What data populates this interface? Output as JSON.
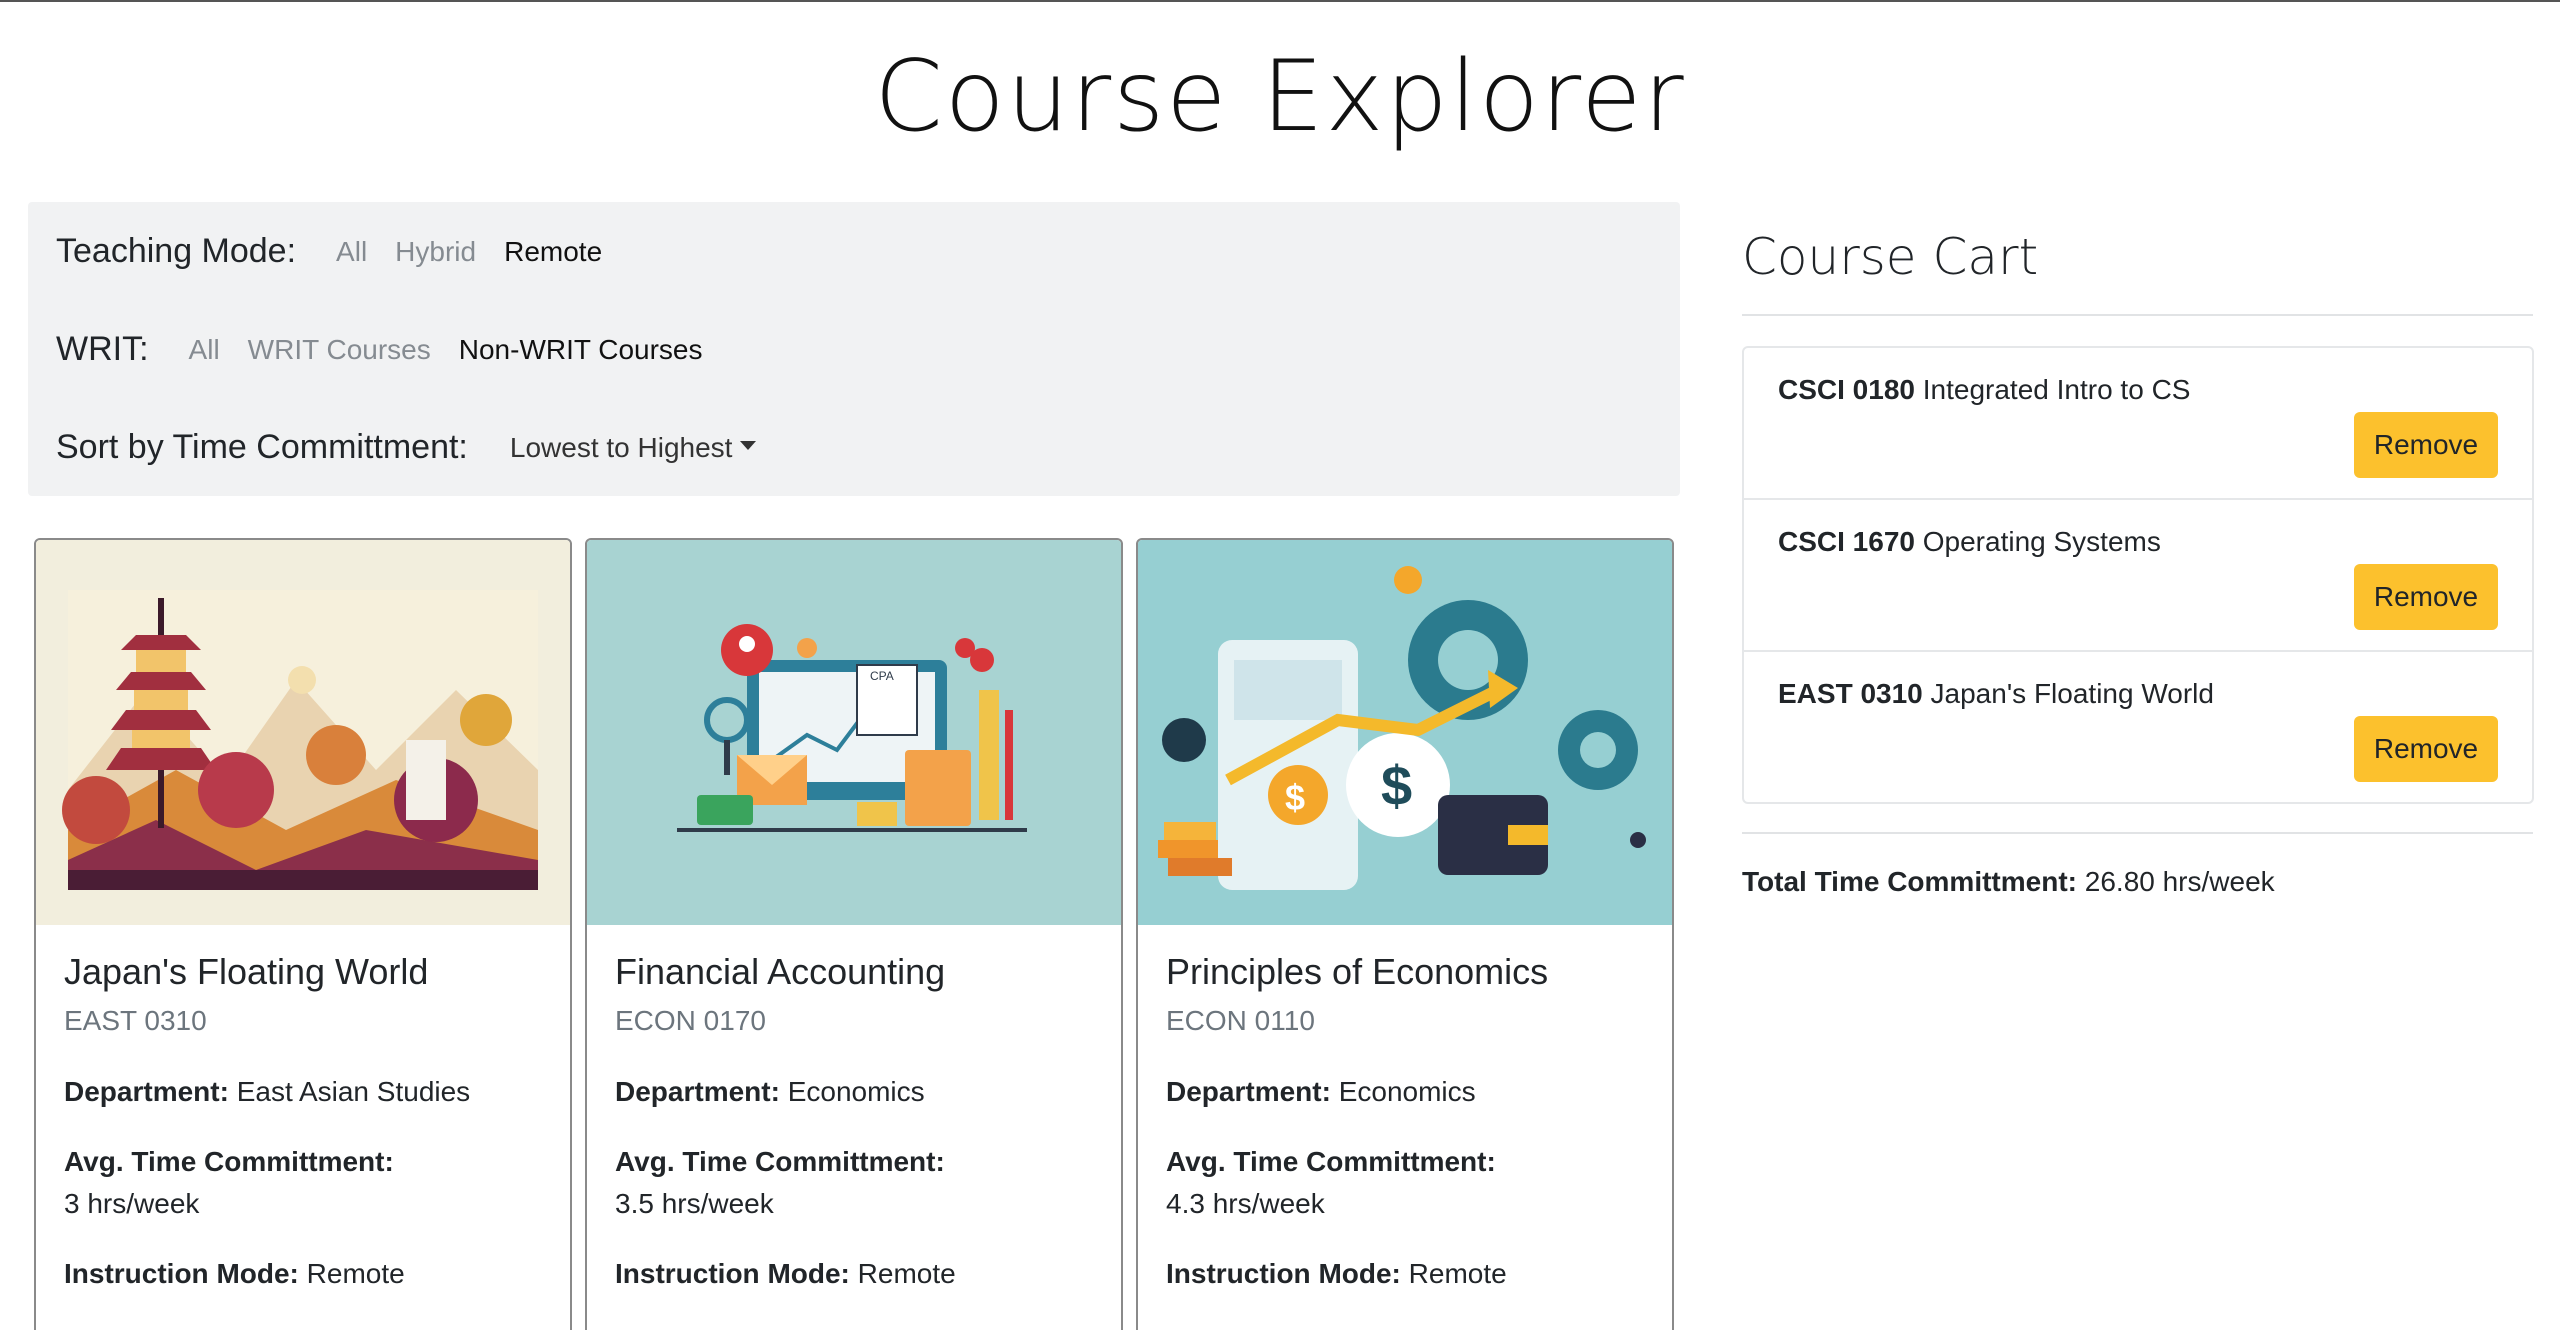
{
  "page": {
    "title": "Course Explorer"
  },
  "filters": {
    "teaching_mode": {
      "label": "Teaching Mode:",
      "options": [
        "All",
        "Hybrid",
        "Remote"
      ],
      "selected": "Remote"
    },
    "writ": {
      "label": "WRIT:",
      "options": [
        "All",
        "WRIT Courses",
        "Non-WRIT Courses"
      ],
      "selected": "Non-WRIT Courses"
    },
    "sort": {
      "label": "Sort by Time Committment:",
      "value": "Lowest to Highest"
    }
  },
  "cards": [
    {
      "title": "Japan's Floating World",
      "code": "EAST 0310",
      "department_label": "Department:",
      "department": "East Asian Studies",
      "time_label": "Avg. Time Committment:",
      "time": "3 hrs/week",
      "mode_label": "Instruction Mode:",
      "mode": "Remote",
      "image_icon": "pagoda-landscape-illustration"
    },
    {
      "title": "Financial Accounting",
      "code": "ECON 0170",
      "department_label": "Department:",
      "department": "Economics",
      "time_label": "Avg. Time Committment:",
      "time": "3.5 hrs/week",
      "mode_label": "Instruction Mode:",
      "mode": "Remote",
      "image_icon": "accounting-illustration"
    },
    {
      "title": "Principles of Economics",
      "code": "ECON 0110",
      "department_label": "Department:",
      "department": "Economics",
      "time_label": "Avg. Time Committment:",
      "time": "4.3 hrs/week",
      "mode_label": "Instruction Mode:",
      "mode": "Remote",
      "image_icon": "economics-illustration"
    }
  ],
  "cart": {
    "title": "Course Cart",
    "items": [
      {
        "code": "CSCI 0180",
        "name": "Integrated Intro to CS",
        "button": "Remove"
      },
      {
        "code": "CSCI 1670",
        "name": "Operating Systems",
        "button": "Remove"
      },
      {
        "code": "EAST 0310",
        "name": "Japan's Floating World",
        "button": "Remove"
      }
    ],
    "total_label": "Total Time Committment:",
    "total_value": "26.80 hrs/week"
  },
  "colors": {
    "remove_button": "#fcc12d",
    "card2_bg": "#a8d3d2",
    "card3_bg": "#96cfd2",
    "card1_bg": "#f2eedd"
  }
}
